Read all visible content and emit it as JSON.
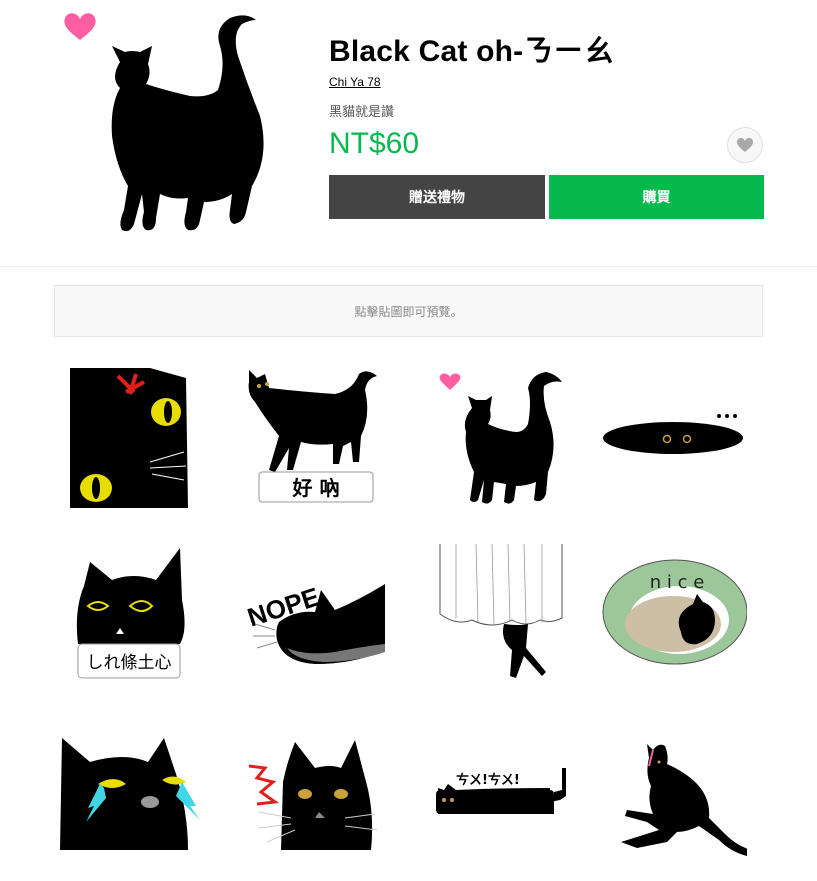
{
  "product": {
    "title": "Black Cat oh-ㄋㄧㄠ",
    "author": "Chi Ya 78",
    "description": "黑貓就是讚",
    "price": "NT$60"
  },
  "actions": {
    "gift_label": "贈送禮物",
    "buy_label": "購買"
  },
  "preview_hint": "點擊貼圖即可預覽。",
  "sticker_text": {
    "s2": "好 吶",
    "s5": "しれ條土心",
    "s6": "NOPE",
    "s8": "n i c e",
    "s11": "ㄘㄨ!ㄘㄨ!"
  },
  "colors": {
    "accent_green": "#06b94d",
    "gift_button": "#444444",
    "heart_pink": "#ff5fa2"
  }
}
